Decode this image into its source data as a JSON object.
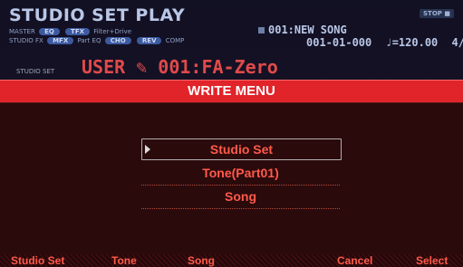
{
  "header": {
    "title": "STUDIO SET PLAY",
    "master_label": "MASTER",
    "studio_fx_label": "STUDIO FX",
    "eq_chip": "EQ",
    "tfx_chip": "TFX",
    "tfx_value": "Filter+Drive",
    "mfx_chip": "MFX",
    "part_eq_label": "Part EQ",
    "cho_chip": "CHO",
    "rev_chip": "REV",
    "comp_label": "COMP",
    "song": "001:NEW SONG",
    "position": "001-01-000",
    "tempo": "♩=120.00",
    "time_sig": "4/",
    "stop_badge": "STOP",
    "studio_set_label": "STUDIO SET",
    "studio_set_name": "USER  ✎ 001:FA-Zero"
  },
  "dialog": {
    "title": "WRITE MENU",
    "items": [
      {
        "label": "Studio Set"
      },
      {
        "label": "Tone(Part01)"
      },
      {
        "label": "Song"
      }
    ]
  },
  "function_bar": {
    "f1": "Studio Set",
    "f2": "Tone",
    "f3": "Song",
    "f5": "Cancel",
    "f6": "Select"
  },
  "colors": {
    "accent_red": "#e0242a",
    "menu_text": "#ff5a4a",
    "dialog_bg": "#2b0a0c"
  }
}
